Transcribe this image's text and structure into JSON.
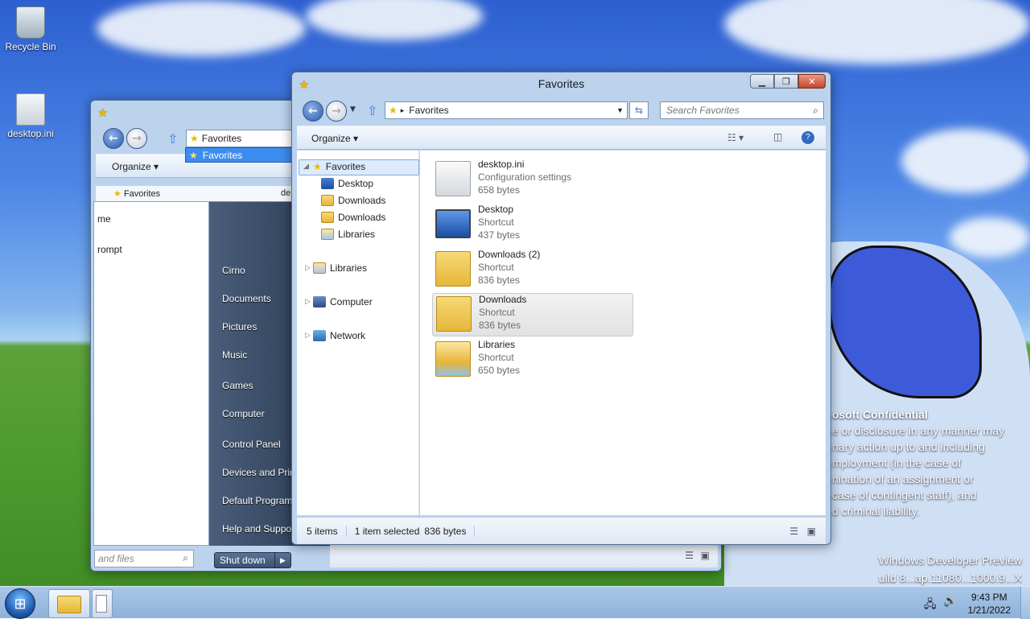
{
  "desktop": {
    "icons": [
      {
        "label": "Recycle Bin"
      },
      {
        "label": "desktop.ini"
      }
    ],
    "watermark": {
      "title": "osoft Confidential",
      "lines": [
        "e or disclosure in any manner may",
        "nary action up to and including",
        "mployment (in the case of",
        "nination of an assignment or",
        "case of contingent staff), and",
        "d criminal liability."
      ]
    },
    "build": [
      "Windows Developer Preview",
      "uild 8...ap.11080...1000.9...X"
    ]
  },
  "back_window": {
    "address": "Favorites",
    "organize": "Organize",
    "nav_favorites": "Favorites",
    "file_header": "de",
    "dropdown_item": "Favorites"
  },
  "start_menu": {
    "left_items": [
      "me",
      "rompt"
    ],
    "right_items": [
      "Cirno",
      "Documents",
      "Pictures",
      "Music",
      "Games",
      "Computer",
      "Control Panel",
      "Devices and Prir",
      "Default Program",
      "Help and Suppo"
    ],
    "search_placeholder": "and files",
    "shutdown": "Shut down"
  },
  "front_window": {
    "title": "Favorites",
    "address": "Favorites",
    "search_placeholder": "Search Favorites",
    "organize": "Organize",
    "nav": {
      "favorites": "Favorites",
      "fav_children": [
        "Desktop",
        "Downloads",
        "Downloads",
        "Libraries"
      ],
      "libraries": "Libraries",
      "computer": "Computer",
      "network": "Network"
    },
    "files": [
      {
        "name": "desktop.ini",
        "type": "Configuration settings",
        "size": "658 bytes"
      },
      {
        "name": "Desktop",
        "type": "Shortcut",
        "size": "437 bytes"
      },
      {
        "name": "Downloads (2)",
        "type": "Shortcut",
        "size": "836 bytes"
      },
      {
        "name": "Downloads",
        "type": "Shortcut",
        "size": "836 bytes"
      },
      {
        "name": "Libraries",
        "type": "Shortcut",
        "size": "650 bytes"
      }
    ],
    "status": {
      "count": "5 items",
      "selected": "1 item selected",
      "size": "836 bytes"
    }
  },
  "taskbar": {
    "time": "9:43 PM",
    "date": "1/21/2022"
  },
  "colors": {
    "selection": "#3c8df0",
    "window_frame": "#bcd3ee",
    "taskbar": "#a9c7e8"
  }
}
